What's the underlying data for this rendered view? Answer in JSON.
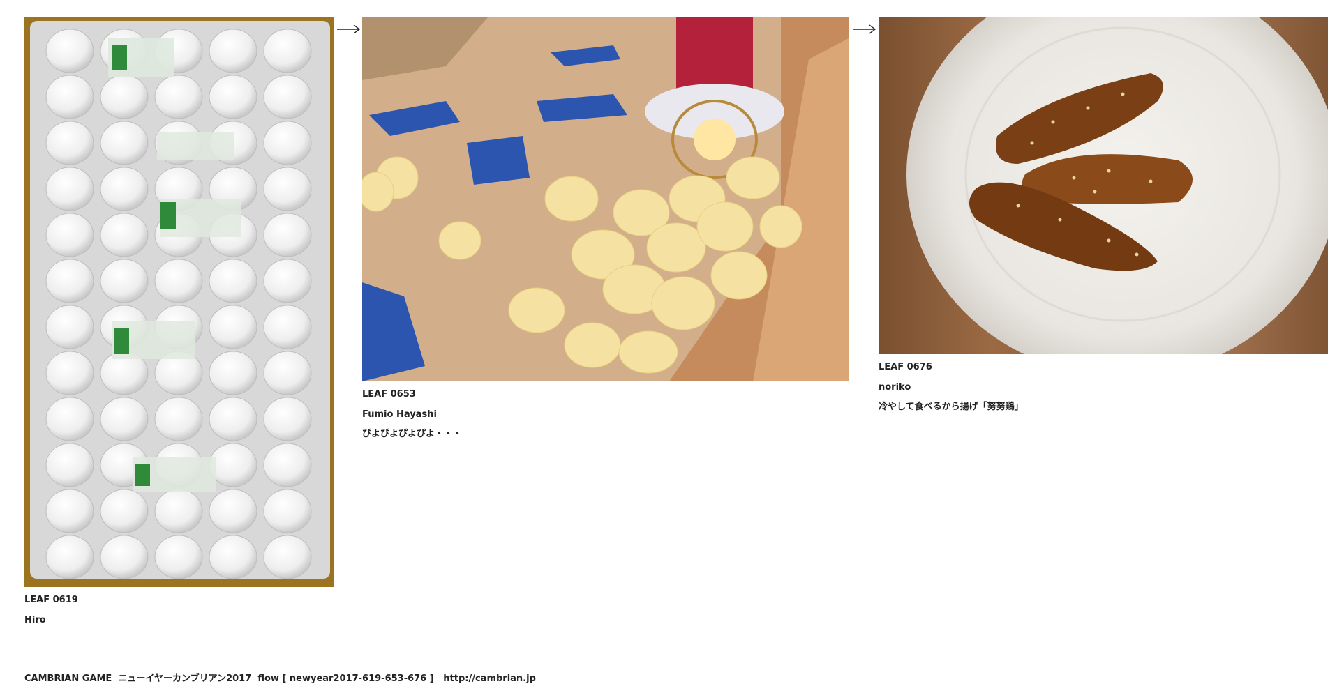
{
  "leaves": [
    {
      "id": "LEAF 0619",
      "author": "Hiro",
      "caption": "",
      "image": "egg-trays-photo"
    },
    {
      "id": "LEAF 0653",
      "author": "Fumio Hayashi",
      "caption": "ぴよぴよぴよぴよ・・・",
      "image": "chicks-under-heat-lamp-photo"
    },
    {
      "id": "LEAF 0676",
      "author": "noriko",
      "caption": "冷やして食べるから揚げ「努努鶏」",
      "image": "fried-chicken-plate-photo"
    }
  ],
  "footer": {
    "brand": "CAMBRIAN GAME",
    "title": "ニューイヤーカンブリアン2017",
    "flow": "flow [ newyear2017-619-653-676 ]",
    "url": "http://cambrian.jp"
  },
  "icons": [
    "arrow-right-icon",
    "arrow-right-icon"
  ],
  "colors": {
    "background": "#ffffff",
    "text": "#222222"
  }
}
